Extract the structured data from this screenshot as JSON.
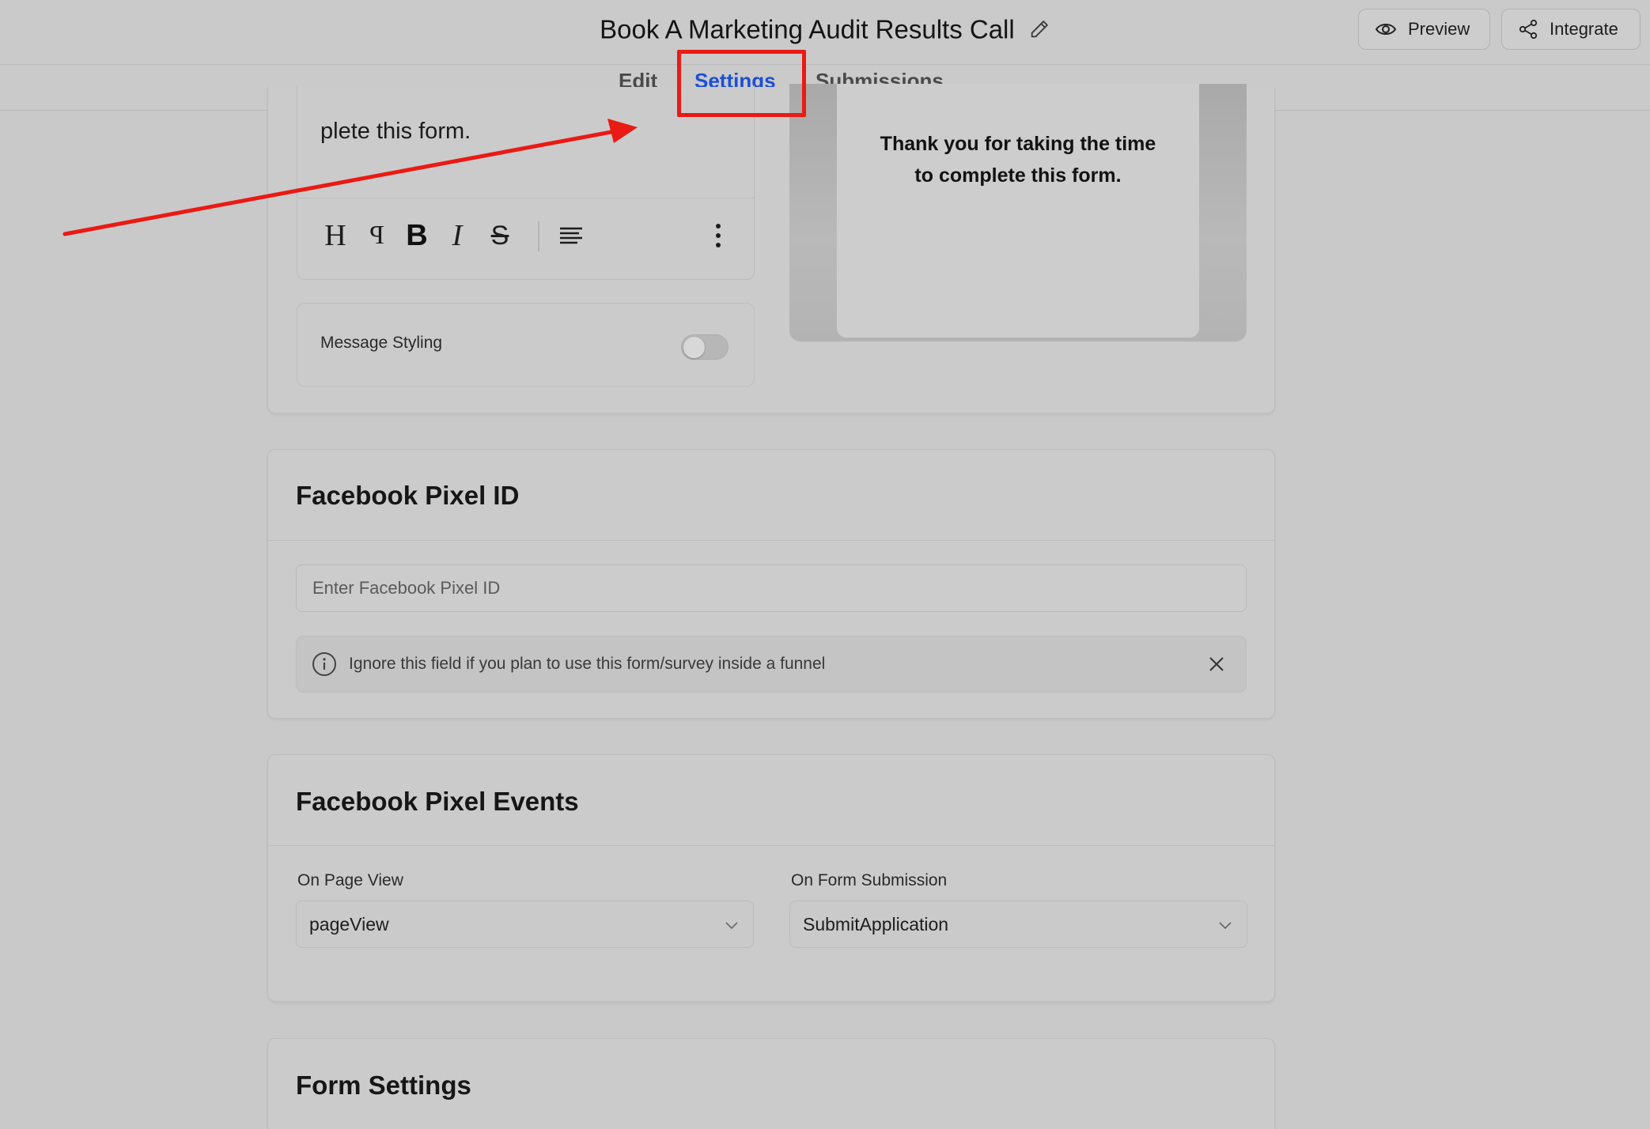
{
  "header": {
    "form_title": "Book A Marketing Audit Results Call",
    "preview_label": "Preview",
    "integrate_label": "Integrate"
  },
  "tabs": {
    "edit": "Edit",
    "settings": "Settings",
    "submissions": "Submissions",
    "active": "Settings"
  },
  "message_card": {
    "editor_text": "plete this form.",
    "toolbar_icons": [
      "heading-icon",
      "paragraph-icon",
      "bold-icon",
      "italic-icon",
      "strikethrough-icon",
      "align-left-icon",
      "more-vertical-icon"
    ],
    "message_styling_label": "Message Styling",
    "message_styling_enabled": false,
    "preview_text": "Thank you for taking the time to complete this form."
  },
  "pixel_id_card": {
    "title": "Facebook Pixel ID",
    "input_placeholder": "Enter Facebook Pixel ID",
    "input_value": "",
    "info_text": "Ignore this field if you plan to use this form/survey inside a funnel"
  },
  "pixel_events_card": {
    "title": "Facebook Pixel Events",
    "page_view_label": "On Page View",
    "page_view_value": "pageView",
    "form_submission_label": "On Form Submission",
    "form_submission_value": "SubmitApplication"
  },
  "form_settings_card": {
    "title": "Form Settings"
  },
  "colors": {
    "accent": "#1c4fd6",
    "annotation": "#ea1a14",
    "background": "#c9c9c9"
  }
}
